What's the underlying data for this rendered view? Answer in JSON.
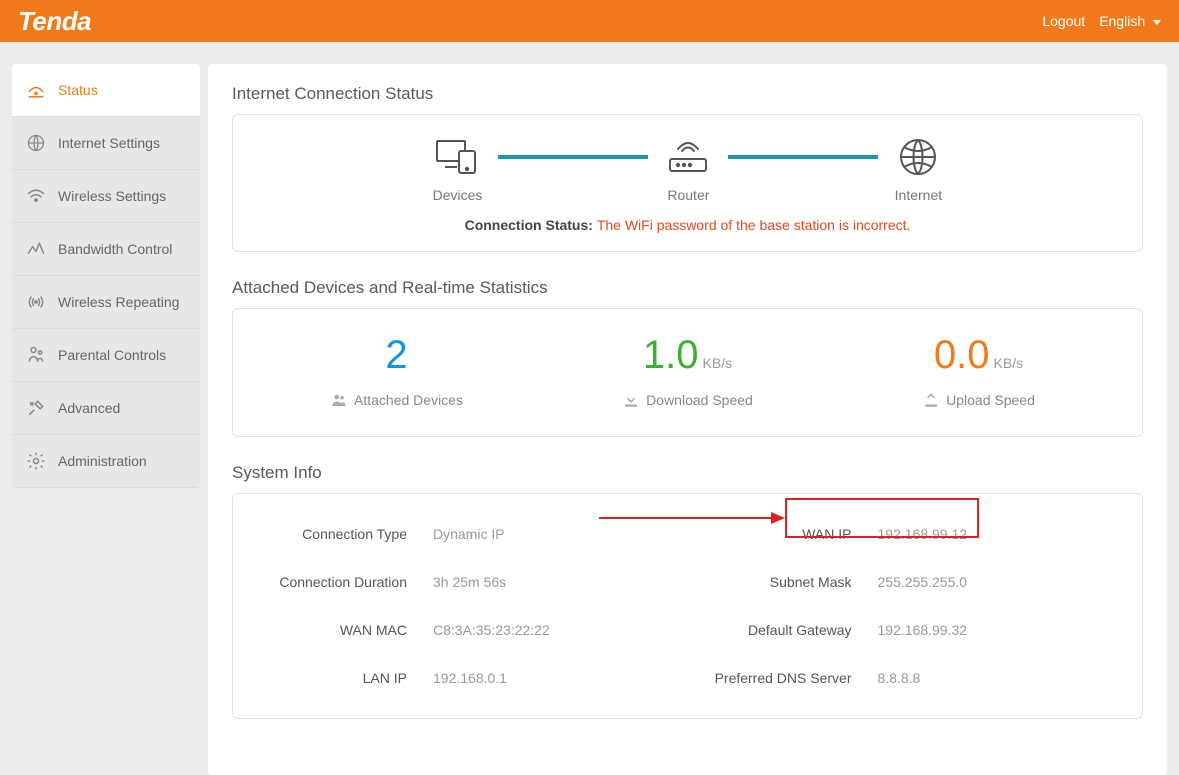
{
  "header": {
    "brand": "Tenda",
    "logout": "Logout",
    "language": "English"
  },
  "sidebar": {
    "items": [
      {
        "label": "Status"
      },
      {
        "label": "Internet Settings"
      },
      {
        "label": "Wireless Settings"
      },
      {
        "label": "Bandwidth Control"
      },
      {
        "label": "Wireless Repeating"
      },
      {
        "label": "Parental Controls"
      },
      {
        "label": "Advanced"
      },
      {
        "label": "Administration"
      }
    ]
  },
  "conn": {
    "section_title": "Internet Connection Status",
    "devices_label": "Devices",
    "router_label": "Router",
    "internet_label": "Internet",
    "status_prefix": "Connection Status: ",
    "status_msg": "The WiFi password of the base station is incorrect."
  },
  "stats": {
    "section_title": "Attached Devices and Real-time Statistics",
    "attached_value": "2",
    "attached_label": "Attached Devices",
    "down_value": "1.0",
    "down_unit": "KB/s",
    "down_label": "Download Speed",
    "up_value": "0.0",
    "up_unit": "KB/s",
    "up_label": "Upload Speed"
  },
  "sysinfo": {
    "section_title": "System Info",
    "rows": [
      {
        "l1": "Connection Type",
        "v1": "Dynamic IP",
        "l2": "WAN IP",
        "v2": "192.168.99.12"
      },
      {
        "l1": "Connection Duration",
        "v1": "3h 25m 56s",
        "l2": "Subnet Mask",
        "v2": "255.255.255.0"
      },
      {
        "l1": "WAN MAC",
        "v1": "C8:3A:35:23:22:22",
        "l2": "Default Gateway",
        "v2": "192.168.99.32"
      },
      {
        "l1": "LAN IP",
        "v1": "192.168.0.1",
        "l2": "Preferred DNS Server",
        "v2": "8.8.8.8"
      }
    ]
  }
}
